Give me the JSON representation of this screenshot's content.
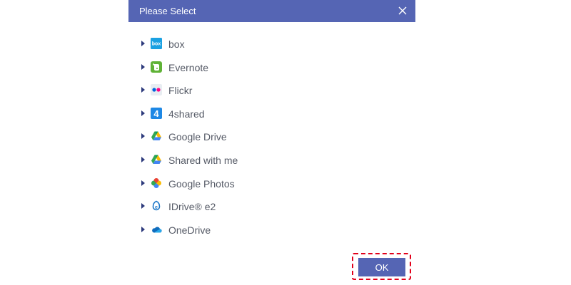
{
  "dialog": {
    "title": "Please Select",
    "ok_label": "OK",
    "colors": {
      "accent": "#5565b4",
      "highlight": "#e2001a",
      "label": "#555a66"
    }
  },
  "tree": {
    "items": [
      {
        "label": "box",
        "icon": "box-icon"
      },
      {
        "label": "Evernote",
        "icon": "evernote-icon"
      },
      {
        "label": "Flickr",
        "icon": "flickr-icon"
      },
      {
        "label": "4shared",
        "icon": "4shared-icon"
      },
      {
        "label": "Google Drive",
        "icon": "google-drive-icon"
      },
      {
        "label": "Shared with me",
        "icon": "google-drive-icon"
      },
      {
        "label": "Google Photos",
        "icon": "google-photos-icon"
      },
      {
        "label": "IDrive® e2",
        "icon": "idrive-e2-icon"
      },
      {
        "label": "OneDrive",
        "icon": "onedrive-icon"
      }
    ]
  }
}
